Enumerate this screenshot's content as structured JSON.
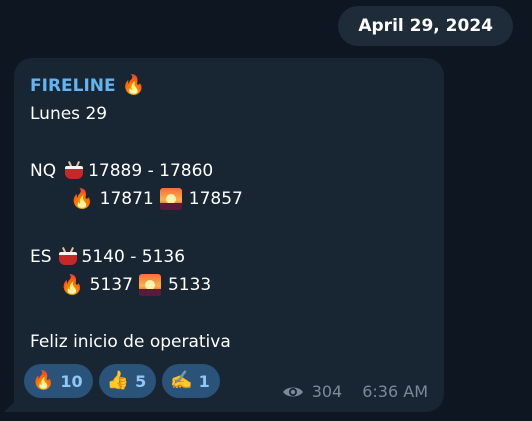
{
  "date_label": "April 29, 2024",
  "message": {
    "sender": "FIRELINE",
    "sender_emoji": "🔥",
    "lines": {
      "day": "Lunes 29",
      "nq_label": "NQ",
      "nq_range": "17889 - 17860",
      "nq_fire_value": "17871",
      "nq_sunrise_value": "17857",
      "es_label": "ES",
      "es_range": "5140 - 5136",
      "es_fire_value": "5137",
      "es_sunrise_value": "5133",
      "closing": "Feliz inicio de operativa"
    },
    "icons": {
      "fire": "🔥",
      "drum": "drum-icon",
      "sunrise": "sunrise-icon"
    }
  },
  "reactions": [
    {
      "emoji": "🔥",
      "count": "10"
    },
    {
      "emoji": "👍",
      "count": "5"
    },
    {
      "emoji": "✍️",
      "count": "1"
    }
  ],
  "meta": {
    "views": "304",
    "time": "6:36 AM"
  }
}
